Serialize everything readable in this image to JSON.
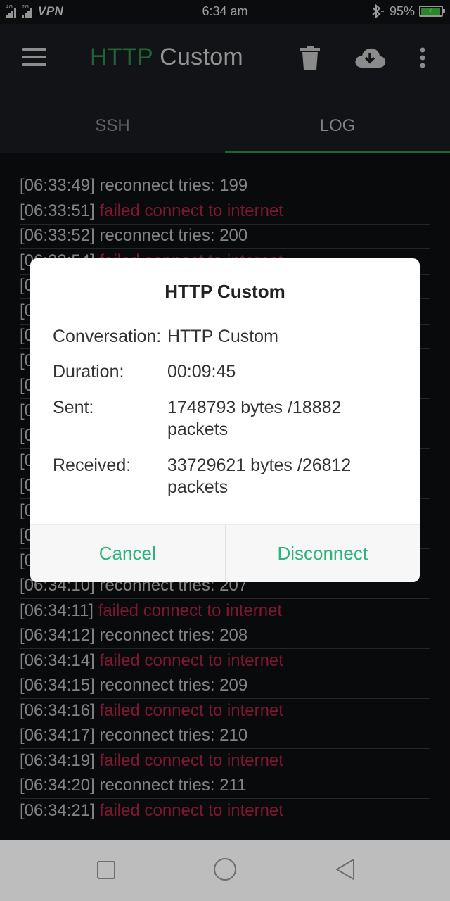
{
  "status_bar": {
    "signal1_tag": "4G",
    "signal2_tag": "2G",
    "vpn": "VPN",
    "time": "6:34 am",
    "battery_percent": "95%",
    "battery_level": 0.95,
    "icons": [
      "signal-icon",
      "bluetooth-icon",
      "battery-icon"
    ]
  },
  "app_bar": {
    "title_part1": "HTTP",
    "title_part2": " Custom",
    "icons": [
      "menu-icon",
      "trash-icon",
      "cloud-download-icon",
      "more-vert-icon"
    ]
  },
  "tabs": [
    {
      "label": "SSH",
      "active": false
    },
    {
      "label": "LOG",
      "active": true
    }
  ],
  "log": [
    {
      "time": "[06:33:49]",
      "msg": " reconnect tries: 199",
      "type": "info"
    },
    {
      "time": "[06:33:51]",
      "msg": " failed connect to internet",
      "type": "error"
    },
    {
      "time": "[06:33:52]",
      "msg": " reconnect tries: 200",
      "type": "info"
    },
    {
      "time": "[06:33:54]",
      "msg": " failed connect to internet",
      "type": "error"
    },
    {
      "time": "[0",
      "msg": "",
      "type": "info"
    },
    {
      "time": "[0",
      "msg": "",
      "type": "info"
    },
    {
      "time": "[0",
      "msg": "",
      "type": "info"
    },
    {
      "time": "[0",
      "msg": "",
      "type": "info"
    },
    {
      "time": "[0",
      "msg": "",
      "type": "info"
    },
    {
      "time": "[0",
      "msg": "",
      "type": "info"
    },
    {
      "time": "[0",
      "msg": "",
      "type": "info"
    },
    {
      "time": "[0",
      "msg": "",
      "type": "info"
    },
    {
      "time": "[0",
      "msg": "",
      "type": "info"
    },
    {
      "time": "[0",
      "msg": "",
      "type": "info"
    },
    {
      "time": "[0",
      "msg": "",
      "type": "info"
    },
    {
      "time": "[0",
      "msg": "",
      "type": "info"
    },
    {
      "time": "[06:34:10]",
      "msg": " reconnect tries: 207",
      "type": "info"
    },
    {
      "time": "[06:34:11]",
      "msg": " failed connect to internet",
      "type": "error"
    },
    {
      "time": "[06:34:12]",
      "msg": " reconnect tries: 208",
      "type": "info"
    },
    {
      "time": "[06:34:14]",
      "msg": " failed connect to internet",
      "type": "error"
    },
    {
      "time": "[06:34:15]",
      "msg": " reconnect tries: 209",
      "type": "info"
    },
    {
      "time": "[06:34:16]",
      "msg": " failed connect to internet",
      "type": "error"
    },
    {
      "time": "[06:34:17]",
      "msg": " reconnect tries: 210",
      "type": "info"
    },
    {
      "time": "[06:34:19]",
      "msg": " failed connect to internet",
      "type": "error"
    },
    {
      "time": "[06:34:20]",
      "msg": " reconnect tries: 211",
      "type": "info"
    },
    {
      "time": "[06:34:21]",
      "msg": " failed connect to internet",
      "type": "error"
    }
  ],
  "dialog": {
    "title": "HTTP Custom",
    "rows": [
      {
        "label": "Conversation:",
        "value": "HTTP Custom"
      },
      {
        "label": "Duration:",
        "value": "00:09:45"
      },
      {
        "label": "Sent:",
        "value": "1748793 bytes /18882 packets"
      },
      {
        "label": "Received:",
        "value": "33729621 bytes /26812 packets"
      }
    ],
    "cancel": "Cancel",
    "disconnect": "Disconnect"
  },
  "colors": {
    "accent": "#2e9b4e",
    "error": "#c2254a",
    "dialog_button": "#2db47e"
  }
}
